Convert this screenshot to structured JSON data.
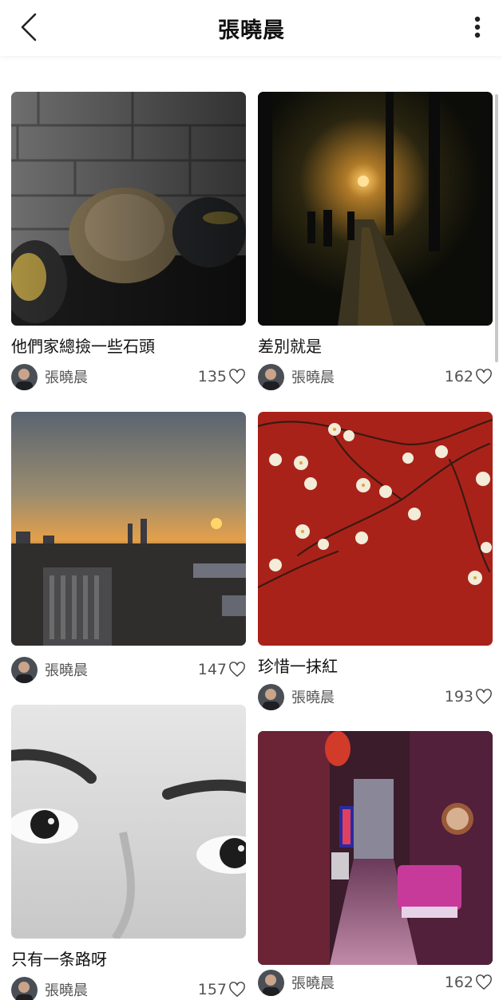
{
  "header": {
    "title": "張曉晨",
    "back_icon": "chevron-left-icon",
    "more_icon": "more-vertical-icon"
  },
  "posts": [
    {
      "title": "他們家總撿一些石頭",
      "author": "張曉晨",
      "likes": "135"
    },
    {
      "title": "差別就是",
      "author": "張曉晨",
      "likes": "162"
    },
    {
      "title": "",
      "author": "張曉晨",
      "likes": "147"
    },
    {
      "title": "珍惜一抹紅",
      "author": "張曉晨",
      "likes": "193"
    },
    {
      "title": "只有一条路呀",
      "author": "張曉晨",
      "likes": "157"
    },
    {
      "title": "",
      "author": "張曉晨",
      "likes": "162"
    }
  ],
  "colors": {
    "text": "#111111",
    "meta": "#555555",
    "background": "#ffffff"
  }
}
